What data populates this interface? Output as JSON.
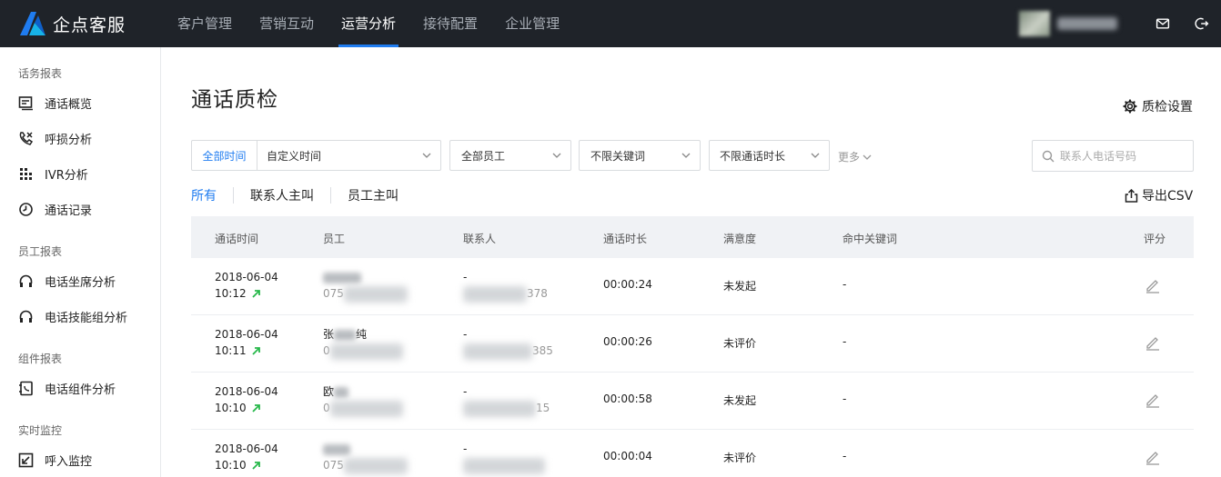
{
  "brand": {
    "name": "企点客服",
    "logo_color": "#1f7cf0"
  },
  "nav": {
    "items": [
      {
        "label": "客户管理"
      },
      {
        "label": "营销互动"
      },
      {
        "label": "运营分析",
        "active": true
      },
      {
        "label": "接待配置"
      },
      {
        "label": "企业管理"
      }
    ]
  },
  "sidebar": {
    "groups": [
      {
        "label": "话务报表",
        "items": [
          {
            "label": "通话概览",
            "icon": "overview-icon"
          },
          {
            "label": "呼损分析",
            "icon": "call-loss-icon"
          },
          {
            "label": "IVR分析",
            "icon": "ivr-grid-icon"
          },
          {
            "label": "通话记录",
            "icon": "clock-icon"
          }
        ]
      },
      {
        "label": "员工报表",
        "items": [
          {
            "label": "电话坐席分析",
            "icon": "headset-icon"
          },
          {
            "label": "电话技能组分析",
            "icon": "headset-icon"
          }
        ]
      },
      {
        "label": "组件报表",
        "items": [
          {
            "label": "电话组件分析",
            "icon": "component-icon"
          }
        ]
      },
      {
        "label": "实时监控",
        "items": [
          {
            "label": "呼入监控",
            "icon": "incoming-icon"
          }
        ]
      }
    ]
  },
  "page": {
    "title": "通话质检",
    "settings_label": "质检设置"
  },
  "filters": {
    "time_scope": "全部时间",
    "time_range": "自定义时间",
    "employee": "全部员工",
    "keyword": "不限关键词",
    "duration": "不限通话时长",
    "more": "更多",
    "search_placeholder": "联系人电话号码",
    "search_value": ""
  },
  "tabs": [
    {
      "label": "所有",
      "active": true
    },
    {
      "label": "联系人主叫"
    },
    {
      "label": "员工主叫"
    }
  ],
  "export_label": "导出CSV",
  "table": {
    "columns": [
      "通话时间",
      "员工",
      "联系人",
      "通话时长",
      "满意度",
      "命中关键词",
      "评分"
    ],
    "rows": [
      {
        "date": "2018-06-04",
        "time": "10:12",
        "emp_name": "",
        "emp_phone": "075",
        "contact_name": "-",
        "contact_tail": "378",
        "duration": "00:00:24",
        "satisfaction": "未发起",
        "keyword": "-"
      },
      {
        "date": "2018-06-04",
        "time": "10:11",
        "emp_name": "张",
        "emp_name_tail": "纯",
        "emp_phone": "0",
        "contact_name": "-",
        "contact_tail": "385",
        "duration": "00:00:26",
        "satisfaction": "未评价",
        "keyword": "-"
      },
      {
        "date": "2018-06-04",
        "time": "10:10",
        "emp_name": "欧",
        "emp_phone": "0",
        "contact_name": "-",
        "contact_tail": "15",
        "duration": "00:00:58",
        "satisfaction": "未发起",
        "keyword": "-"
      },
      {
        "date": "2018-06-04",
        "time": "10:10",
        "emp_name": "",
        "emp_phone": "075",
        "contact_name": "-",
        "contact_tail": "",
        "duration": "00:00:04",
        "satisfaction": "未评价",
        "keyword": "-"
      }
    ]
  },
  "colors": {
    "topbar": "#1f2329",
    "accent": "#1f7cf0",
    "arrow": "#27b84a"
  }
}
